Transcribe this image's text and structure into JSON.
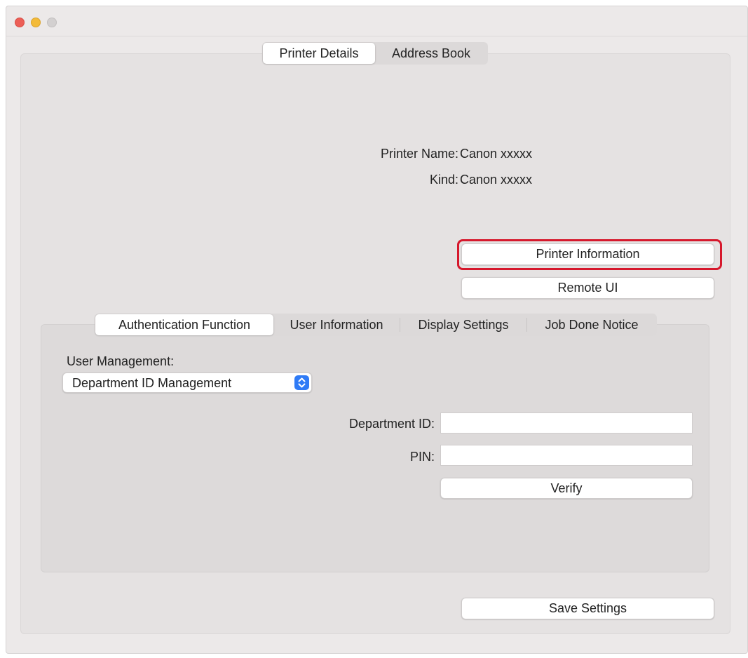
{
  "window": {
    "tabs": [
      {
        "label": "Printer Details",
        "selected": true
      },
      {
        "label": "Address Book",
        "selected": false
      }
    ]
  },
  "printer_details": {
    "printer_name_label": "Printer Name:",
    "printer_name_value": "Canon xxxxx",
    "kind_label": "Kind:",
    "kind_value": "Canon xxxxx",
    "printer_information_button": "Printer Information",
    "remote_ui_button": "Remote UI"
  },
  "sub_tabs": [
    {
      "label": "Authentication Function",
      "selected": true
    },
    {
      "label": "User Information",
      "selected": false
    },
    {
      "label": "Display Settings",
      "selected": false
    },
    {
      "label": "Job Done Notice",
      "selected": false
    }
  ],
  "authentication": {
    "user_management_label": "User Management:",
    "user_management_value": "Department ID Management",
    "department_id_label": "Department ID:",
    "department_id_value": "",
    "pin_label": "PIN:",
    "pin_value": "",
    "verify_button": "Verify"
  },
  "footer": {
    "save_settings_button": "Save Settings"
  },
  "icons": {
    "popup_stepper": "up-down-chevron-icon"
  },
  "colors": {
    "highlight": "#d6182c",
    "accent": "#2f7bf6"
  }
}
